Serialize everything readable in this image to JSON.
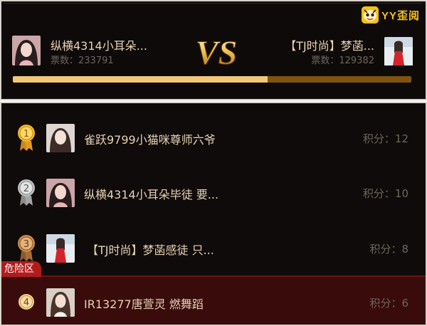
{
  "brand": {
    "logo_text": "YY歪阅"
  },
  "battle": {
    "left": {
      "name": "纵横4314小耳朵...",
      "votes": "票数：233791",
      "avatar": "female-streamer-avatar"
    },
    "right": {
      "name": "【TJ时尚】梦菡...",
      "votes": "票数：129382",
      "avatar": "female-streamer-red-dress-avatar"
    },
    "vs_label": "VS",
    "progress_left_fraction": 0.64,
    "colors": {
      "left_bar": "#f0c878",
      "right_bar": "#80540f",
      "accent": "#f4c21a"
    }
  },
  "ranking": {
    "items": [
      {
        "rank": "1",
        "medal": "gold-medal",
        "name": "雀跃9799小猫咪尊师六爷",
        "score": "积分：12"
      },
      {
        "rank": "2",
        "medal": "silver-medal",
        "name": "纵横4314小耳朵毕徒 要...",
        "score": "积分：10"
      },
      {
        "rank": "3",
        "medal": "bronze-medal",
        "name": "【TJ时尚】梦菡感徒 只...",
        "score": "积分：8"
      },
      {
        "rank": "4",
        "medal": "plain-badge",
        "name": "IR13277唐萱灵 燃舞蹈",
        "score": "积分：6"
      }
    ],
    "danger_zone_label": "危险区",
    "colors": {
      "danger_bg": "#3a0b0b",
      "danger_tag": "#b21b1b"
    }
  }
}
